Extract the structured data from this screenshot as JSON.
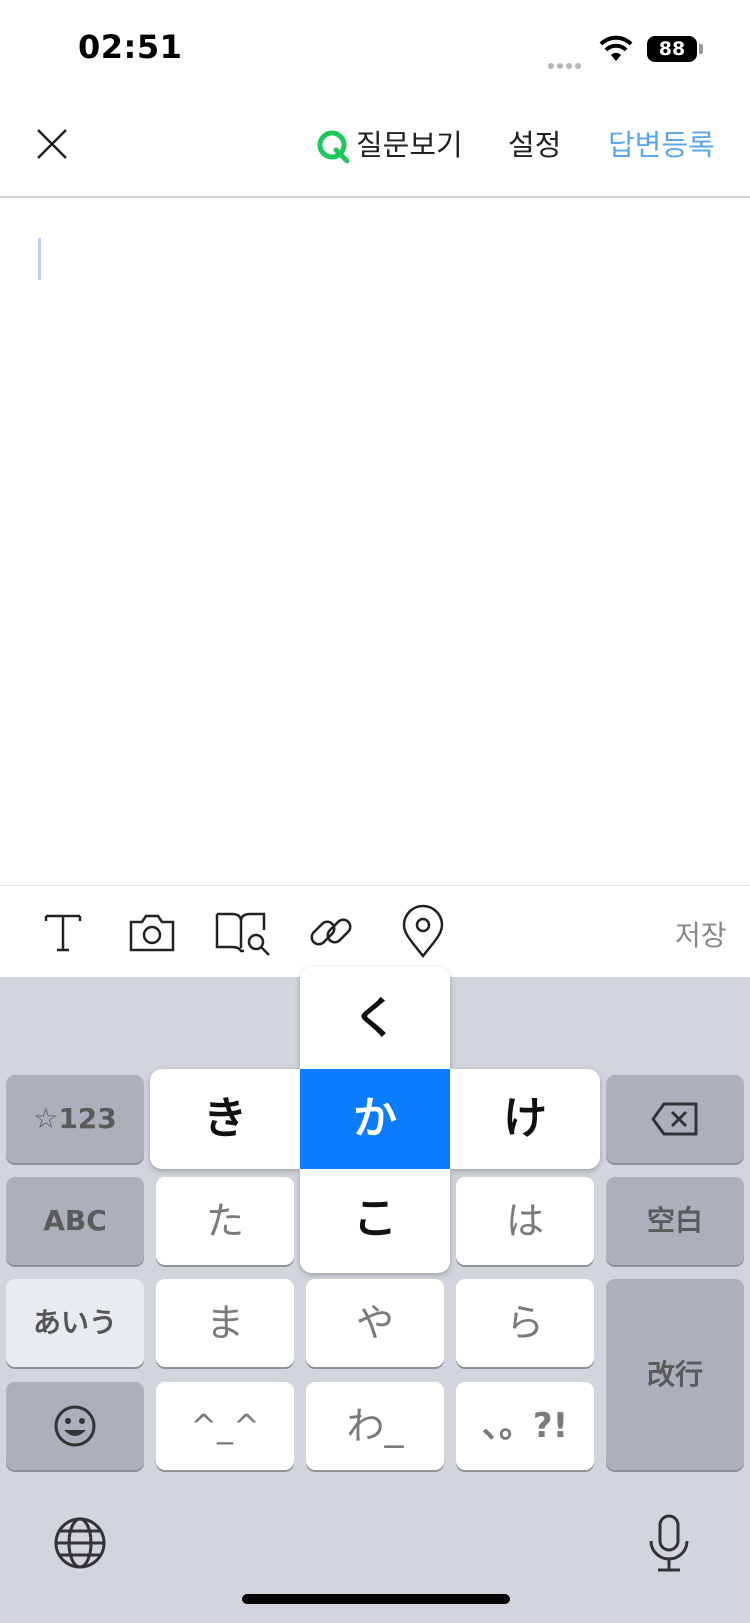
{
  "status_bar": {
    "time": "02:51",
    "battery": "88"
  },
  "header": {
    "view_question": "질문보기",
    "settings": "설정",
    "submit_answer": "답변등록"
  },
  "toolbar": {
    "save": "저장"
  },
  "keyboard": {
    "flick_up": "く",
    "flick_left": "き",
    "flick_center": "か",
    "flick_right": "け",
    "flick_down": "こ",
    "key_symbols": "☆123",
    "key_abc": "ABC",
    "key_aiu": "あいう",
    "key_ta": "た",
    "key_ha": "は",
    "key_space": "空白",
    "key_ma": "ま",
    "key_ya": "や",
    "key_ra": "ら",
    "key_return": "改行",
    "key_kaomoji": "^_^",
    "key_wa": "わ_",
    "key_punct": "、。?!"
  },
  "icons": [
    "close-icon",
    "q-icon",
    "text-format-icon",
    "camera-icon",
    "book-search-icon",
    "link-icon",
    "location-pin-icon",
    "backspace-icon",
    "emoji-icon",
    "globe-icon",
    "microphone-icon"
  ],
  "colors": {
    "accent_blue": "#5aa7ee",
    "q_green": "#1ec85a",
    "key_highlight": "#0a7cff"
  }
}
